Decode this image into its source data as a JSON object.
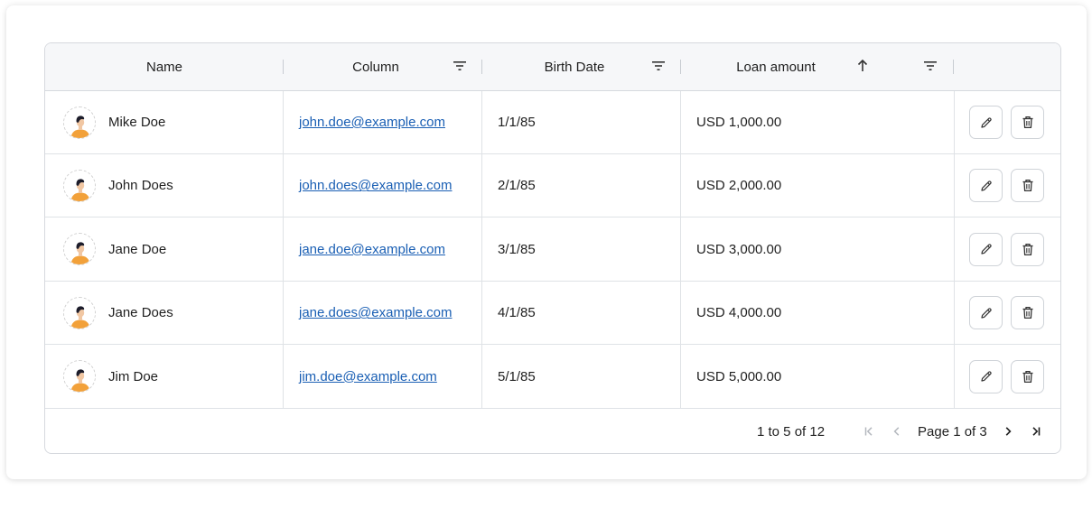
{
  "columns": {
    "name": "Name",
    "column": "Column",
    "birth_date": "Birth Date",
    "loan_amount": "Loan amount"
  },
  "rows": [
    {
      "name": "Mike Doe",
      "email": "john.doe@example.com",
      "birth_date": "1/1/85",
      "loan": "USD 1,000.00"
    },
    {
      "name": "John Does",
      "email": "john.does@example.com",
      "birth_date": "2/1/85",
      "loan": "USD 2,000.00"
    },
    {
      "name": "Jane Doe",
      "email": "jane.doe@example.com",
      "birth_date": "3/1/85",
      "loan": "USD 3,000.00"
    },
    {
      "name": "Jane Does",
      "email": "jane.does@example.com",
      "birth_date": "4/1/85",
      "loan": "USD 4,000.00"
    },
    {
      "name": "Jim Doe",
      "email": "jim.doe@example.com",
      "birth_date": "5/1/85",
      "loan": "USD 5,000.00"
    }
  ],
  "pagination": {
    "range": "1 to 5 of 12",
    "page": "Page 1 of 3"
  },
  "icons": {
    "filter": "filter-icon",
    "sort": "sort-ascending-icon",
    "edit": "pencil-icon",
    "delete": "trash-icon",
    "first": "first-page-icon",
    "prev": "chevron-left-icon",
    "next": "chevron-right-icon",
    "last": "last-page-icon"
  },
  "colors": {
    "link": "#1a5fb4",
    "header_bg": "#f6f7f9",
    "border": "#d6d9de"
  }
}
